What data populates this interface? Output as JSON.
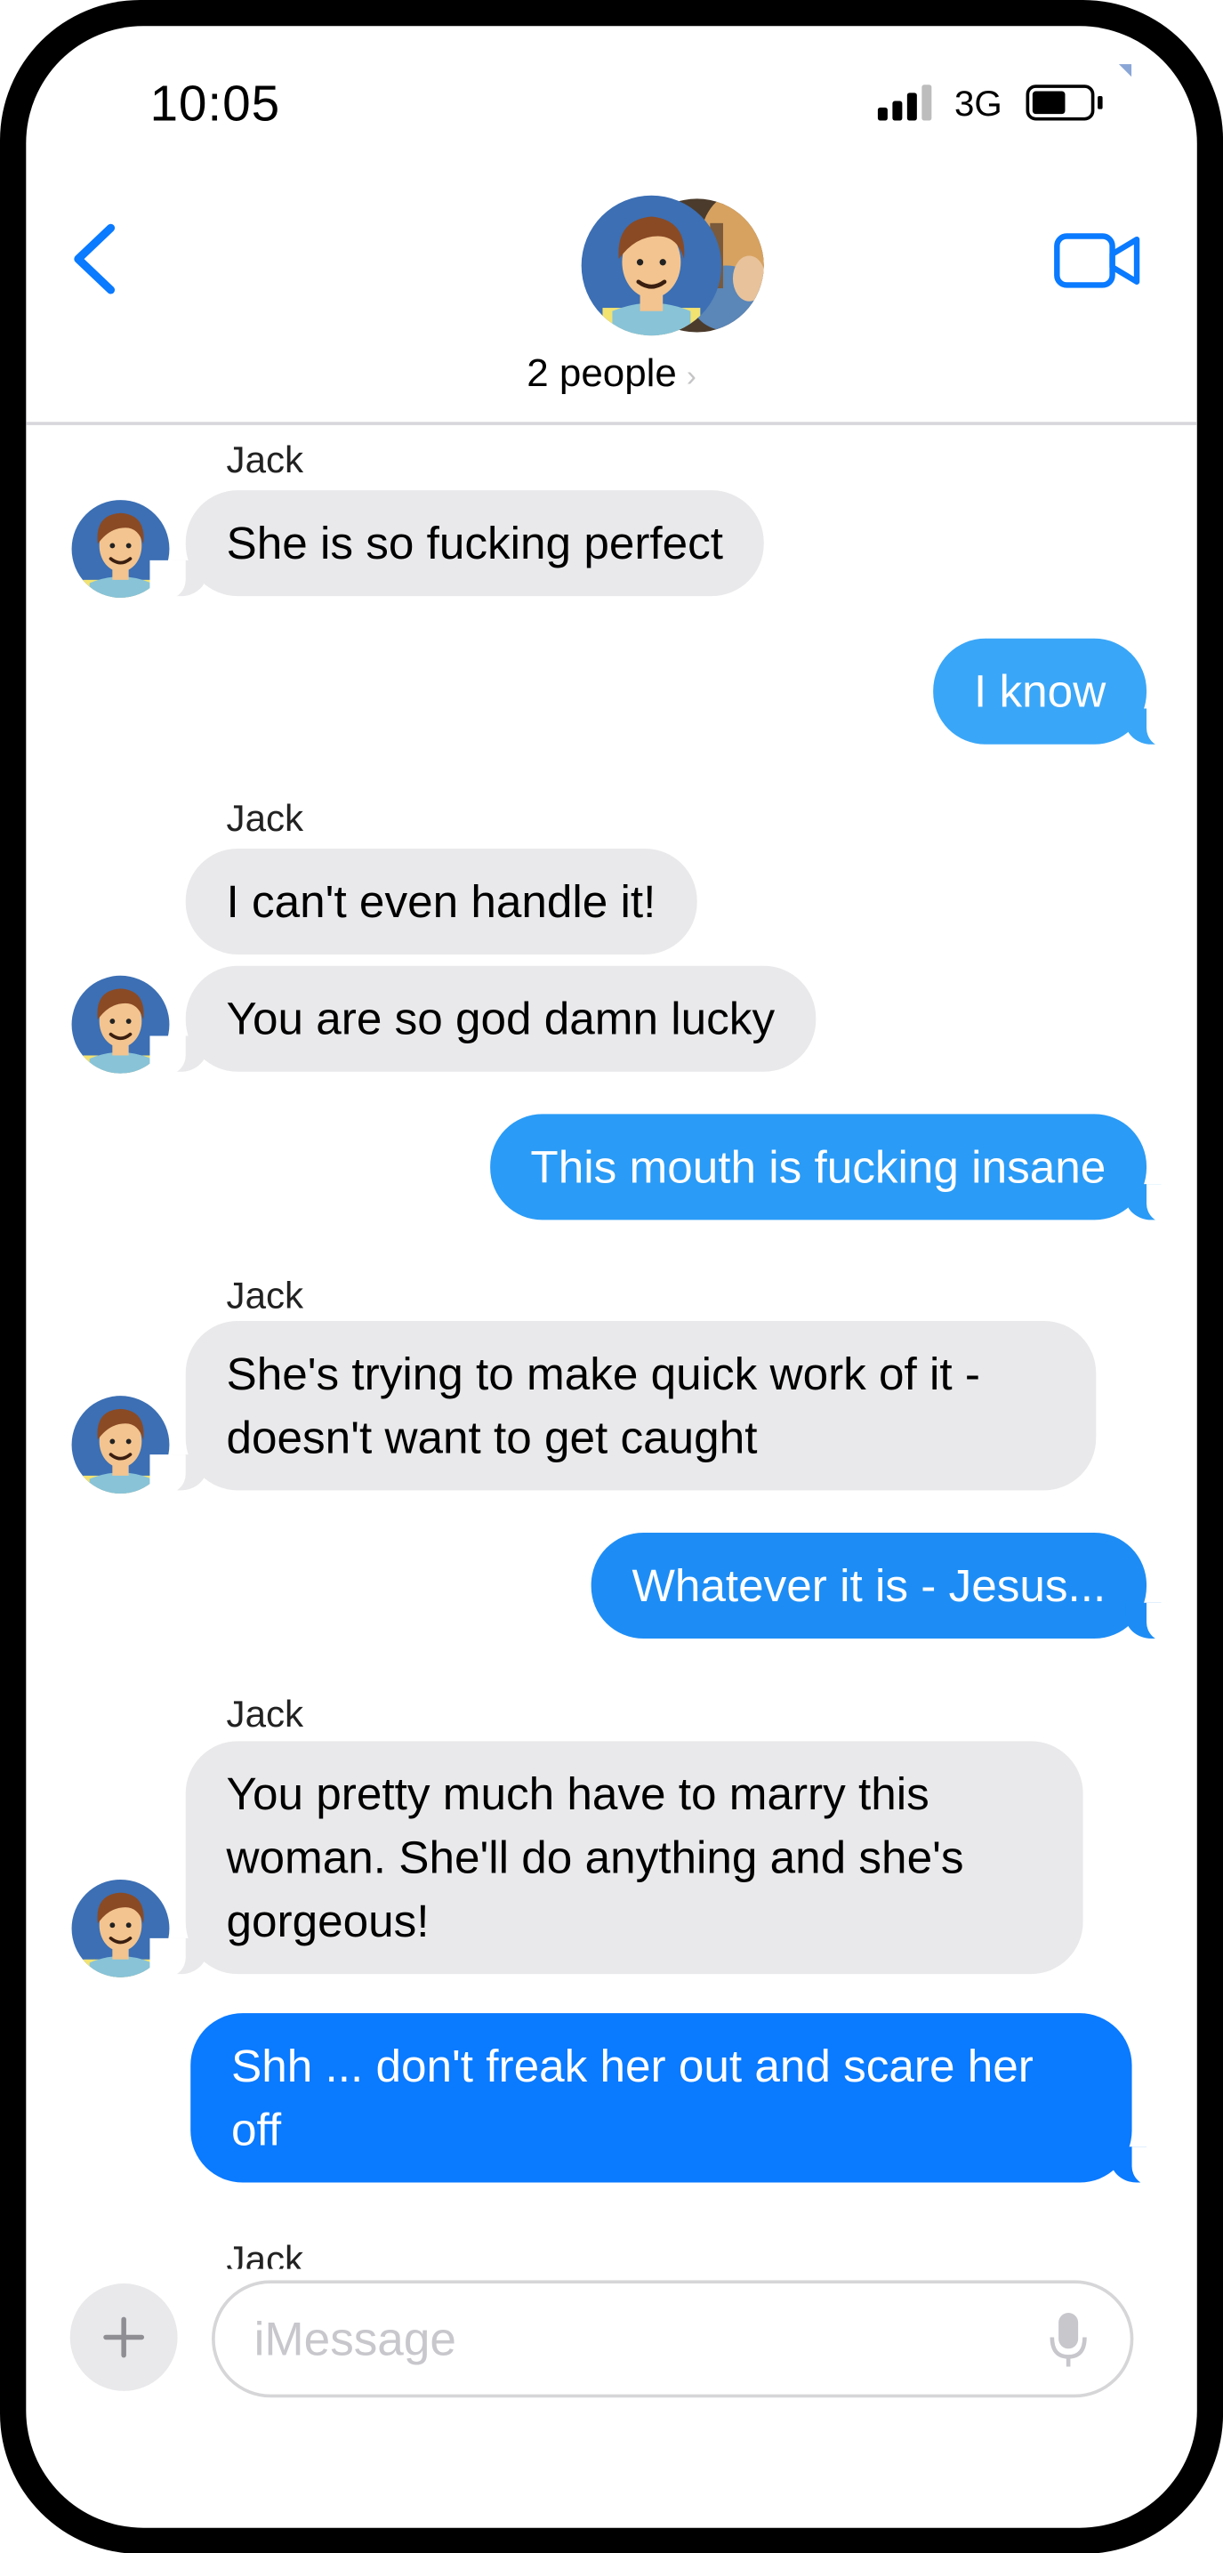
{
  "status_bar": {
    "time": "10:05",
    "network": "3G"
  },
  "header": {
    "group_label": "2 people",
    "chevron": "›"
  },
  "colors": {
    "accent": "#0a7aff",
    "incoming_bubble": "#e9e9eb",
    "outgoing_light": "#3aa6f7",
    "outgoing_mid": "#1d8df5",
    "outgoing_dark": "#0a7aff"
  },
  "messages": [
    {
      "sender": "Jack",
      "text": "She is so fucking perfect"
    },
    {
      "text": "I know"
    },
    {
      "sender": "Jack",
      "text": "I can't even handle it!"
    },
    {
      "text": "You are so god damn lucky"
    },
    {
      "text": "This mouth is fucking insane"
    },
    {
      "sender": "Jack",
      "line1": "She's trying to make quick work of it -",
      "line2": "doesn't want to get caught"
    },
    {
      "text": "Whatever it is - Jesus..."
    },
    {
      "sender": "Jack",
      "line1": "You pretty much have to marry this",
      "line2": "woman.  She'll do anything and she's",
      "line3": "gorgeous!"
    },
    {
      "line1": "Shh ... don't freak her out and scare her",
      "line2": "off"
    },
    {
      "sender": "Jack"
    }
  ],
  "composer": {
    "placeholder": "iMessage"
  },
  "icons": [
    "back-chevron-icon",
    "video-camera-icon",
    "plus-icon",
    "microphone-icon",
    "signal-icon",
    "battery-icon"
  ]
}
